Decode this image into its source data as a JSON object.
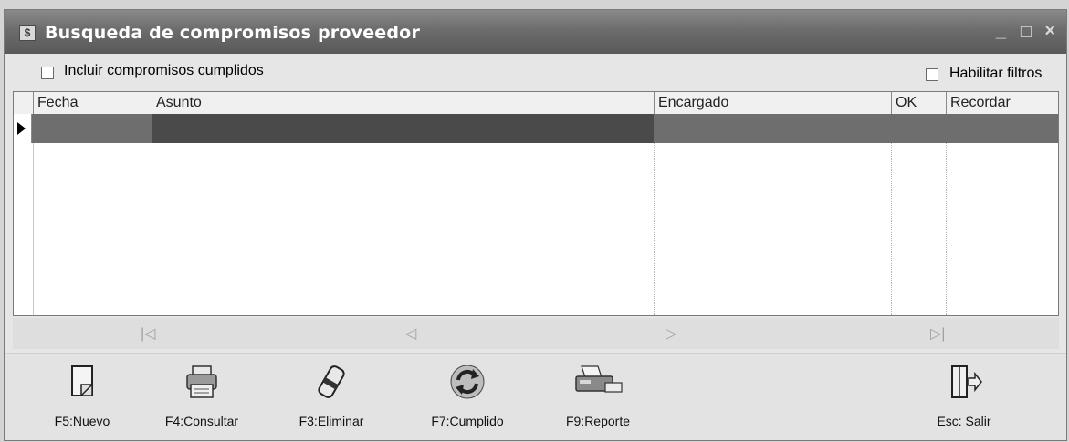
{
  "window": {
    "title": "Busqueda de compromisos proveedor",
    "icon": "app-icon",
    "controls": [
      "minimize",
      "maximize",
      "close"
    ]
  },
  "filters": {
    "include_completed_label": "Incluir compromisos cumplidos",
    "include_completed_checked": false,
    "enable_filters_label": "Habilitar filtros",
    "enable_filters_checked": false
  },
  "grid": {
    "columns": [
      "Fecha",
      "Asunto",
      "Encargado",
      "OK",
      "Recordar"
    ],
    "rows": [
      {
        "fecha": "",
        "asunto": "",
        "encargado": "",
        "ok": "",
        "recordar": "",
        "selected": true
      }
    ]
  },
  "navigator": {
    "buttons": [
      "first",
      "previous",
      "next",
      "last"
    ],
    "icons": {
      "first": "|◁",
      "previous": "◁",
      "next": "▷",
      "last": "▷|"
    }
  },
  "toolbar": {
    "nuevo": "F5:Nuevo",
    "consultar": "F4:Consultar",
    "eliminar": "F3:Eliminar",
    "cumplido": "F7:Cumplido",
    "reporte": "F9:Reporte",
    "salir": "Esc: Salir"
  }
}
